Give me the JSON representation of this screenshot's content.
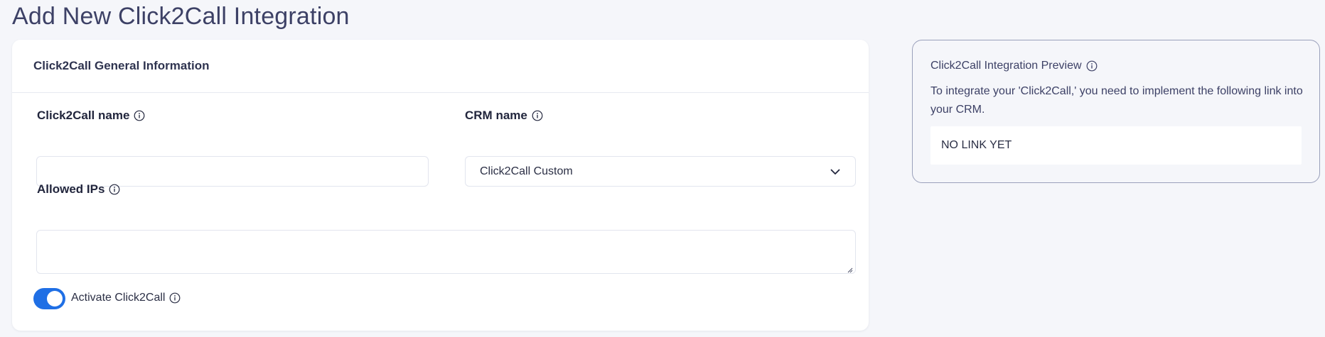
{
  "page": {
    "title": "Add New Click2Call Integration"
  },
  "general": {
    "header": "Click2Call General Information",
    "name_label": "Click2Call name",
    "name_value": "",
    "crm_label": "CRM name",
    "crm_value": "Click2Call Custom",
    "ips_label": "Allowed IPs",
    "ips_value": "",
    "activate_label": "Activate Click2Call",
    "activate_on": true
  },
  "preview": {
    "title": "Click2Call Integration Preview",
    "description": "To integrate your 'Click2Call,' you need to implement the following link into your CRM.",
    "link": "NO LINK YET"
  },
  "colors": {
    "accent": "#1f6fe5",
    "background": "#f5f6fa",
    "title": "#3d4166"
  },
  "icons": [
    "info-icon",
    "chevron-down-icon",
    "resize-grip-icon"
  ]
}
